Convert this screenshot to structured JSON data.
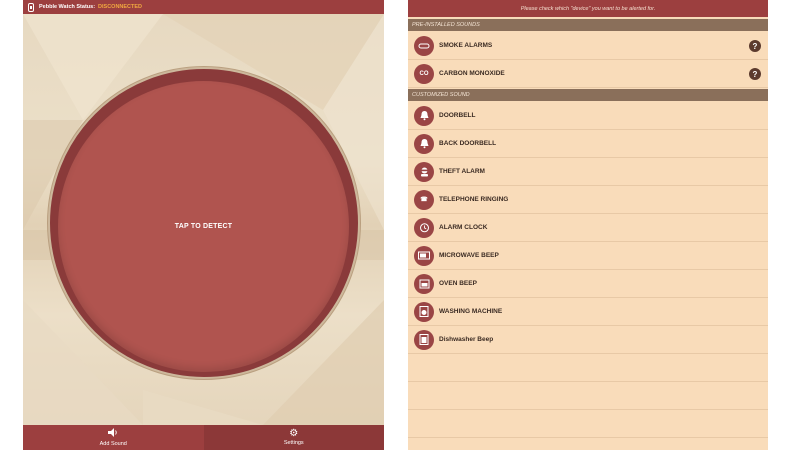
{
  "left": {
    "status": {
      "label": "Pebble Watch Status:",
      "value": "DISCONNECTED"
    },
    "detect_label": "TAP TO DETECT",
    "nav": [
      {
        "label": "Add Sound",
        "icon": "speaker-icon"
      },
      {
        "label": "Settings",
        "icon": "gear-icon"
      }
    ]
  },
  "right": {
    "instruction": "Please check which \"device\" you want to be alerted for.",
    "pre_installed_header": "PRE-INSTALLED SOUNDS",
    "pre_installed": [
      {
        "label": "SMOKE ALARMS",
        "icon": "smoke-detector-icon",
        "help": "?"
      },
      {
        "label": "CARBON MONOXIDE",
        "icon": "co-icon",
        "icon_text": "CO",
        "help": "?"
      }
    ],
    "customized_header": "CUSTOMIZED SOUND",
    "customized": [
      {
        "label": "DOORBELL",
        "icon": "bell-icon"
      },
      {
        "label": "BACK DOORBELL",
        "icon": "bell-icon"
      },
      {
        "label": "THEFT ALARM",
        "icon": "thief-icon"
      },
      {
        "label": "TELEPHONE RINGING",
        "icon": "telephone-icon"
      },
      {
        "label": "ALARM CLOCK",
        "icon": "clock-icon"
      },
      {
        "label": "MICROWAVE BEEP",
        "icon": "microwave-icon"
      },
      {
        "label": "OVEN BEEP",
        "icon": "oven-icon"
      },
      {
        "label": "WASHING MACHINE",
        "icon": "washing-machine-icon"
      },
      {
        "label": "Dishwasher Beep",
        "icon": "dishwasher-icon"
      }
    ]
  },
  "colors": {
    "primary": "#9c3f3f",
    "button": "#b0544f",
    "list_bg": "#f9dcba",
    "section": "#8a6f5a",
    "warning": "#f0a840"
  }
}
